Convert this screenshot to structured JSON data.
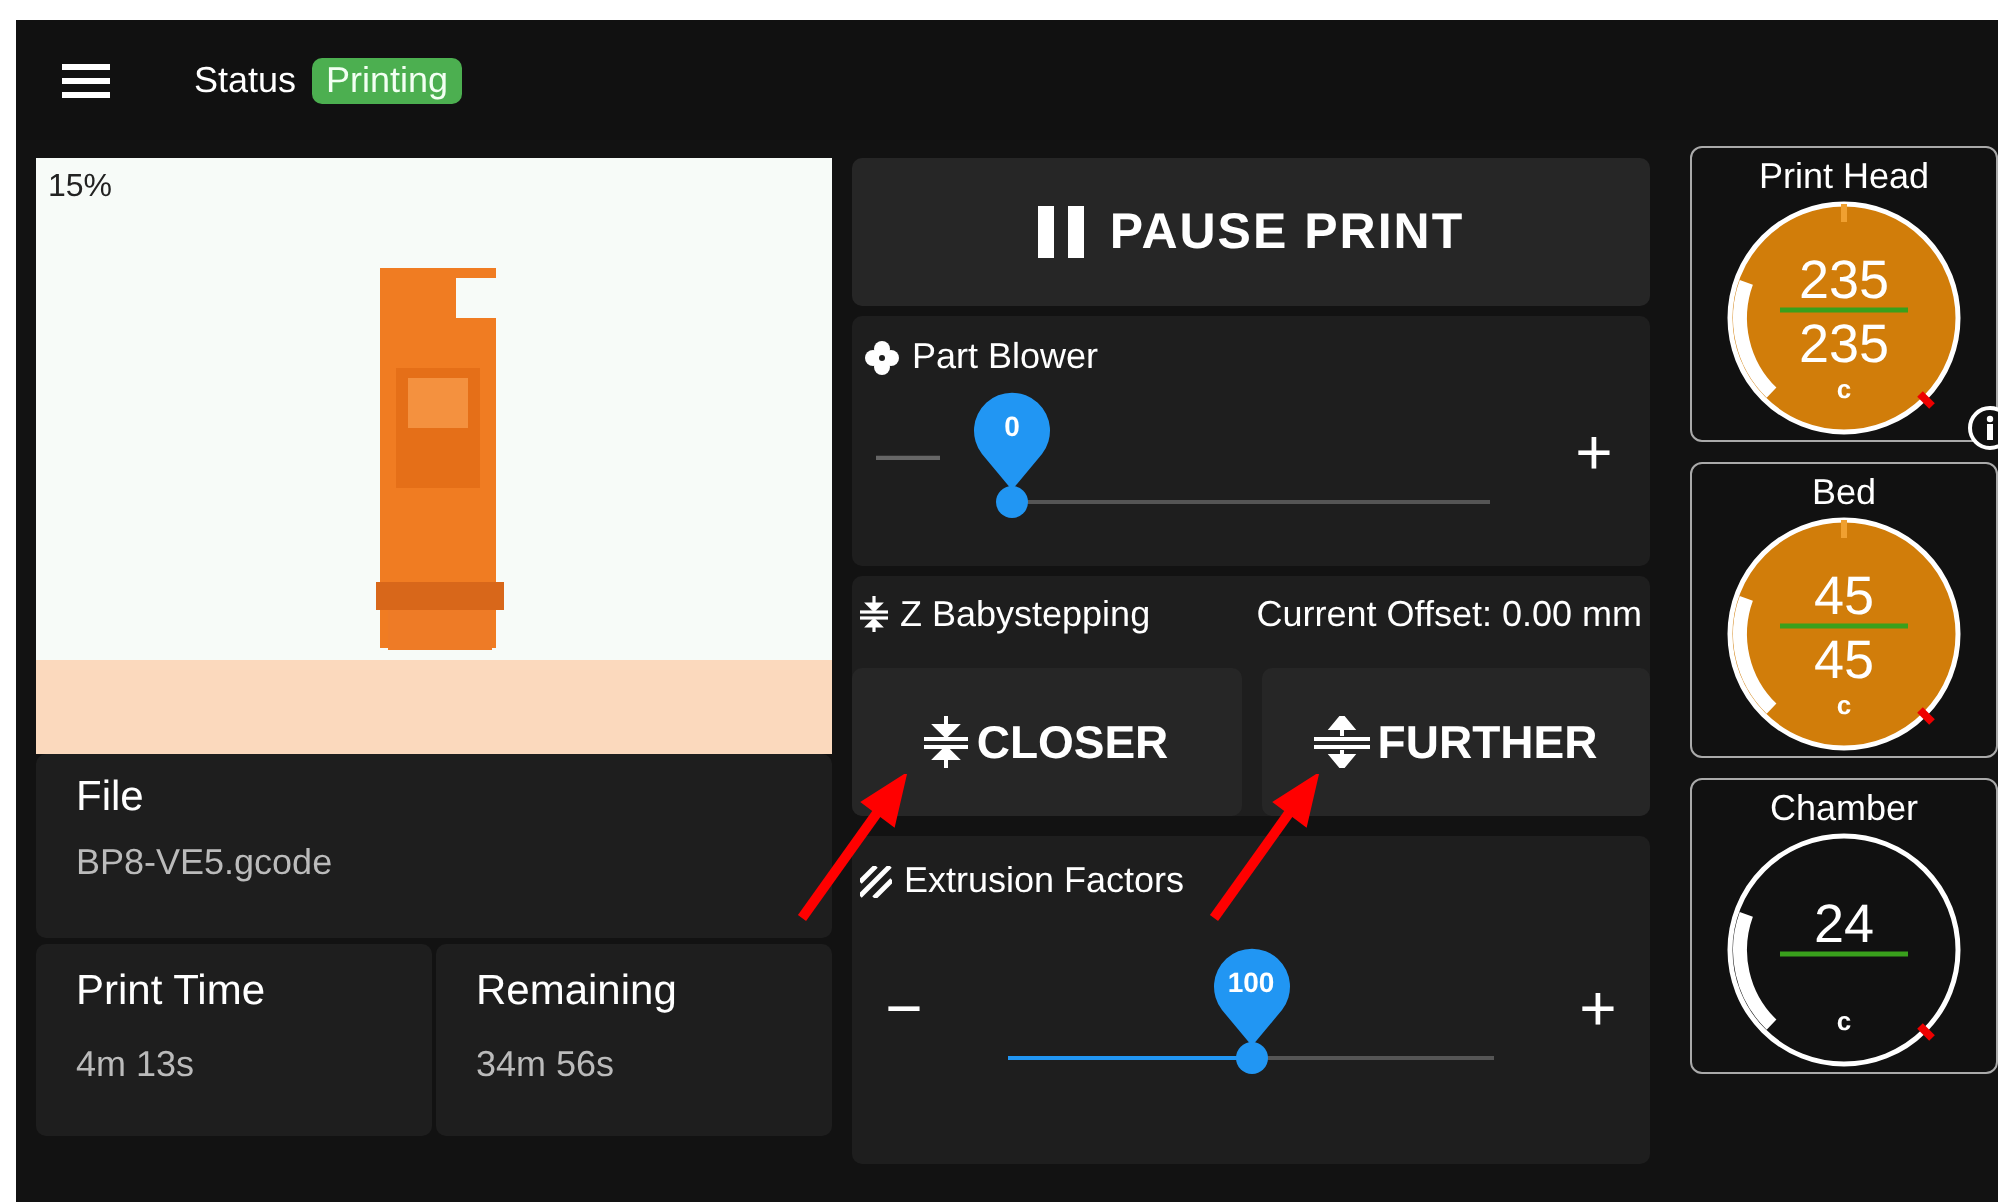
{
  "top_bar": {
    "status_label": "Status",
    "status_badge": "Printing"
  },
  "preview": {
    "progress": "15%",
    "kind": "picture"
  },
  "file": {
    "label": "File",
    "value": "BP8-VE5.gcode"
  },
  "times": [
    {
      "label": "Print Time",
      "value": "4m 13s"
    },
    {
      "label": "Remaining",
      "value": "34m 56s"
    }
  ],
  "pause_button": "PAUSE PRINT",
  "part_blower": {
    "title": "Part Blower",
    "value": "0",
    "level": 0,
    "minus": "—",
    "plus": "+"
  },
  "babystepping": {
    "title": "Z Babystepping",
    "offset": "Current Offset: 0.00 mm",
    "buttons": [
      {
        "label": "CLOSER",
        "kind": "closer"
      },
      {
        "label": "FURTHER",
        "kind": "further"
      }
    ]
  },
  "extrusion": {
    "title": "Extrusion Factors",
    "value": "100",
    "level": 0.5,
    "minus": "−",
    "plus": "+"
  },
  "heaters": [
    {
      "name": "Print Head",
      "current": "235",
      "target": "235",
      "unit": "c",
      "heating": true,
      "info": true
    },
    {
      "name": "Bed",
      "current": "45",
      "target": "45",
      "unit": "c",
      "heating": true,
      "info": false
    },
    {
      "name": "Chamber",
      "current": "24",
      "unit": "c",
      "heating": false,
      "info": false
    }
  ]
}
